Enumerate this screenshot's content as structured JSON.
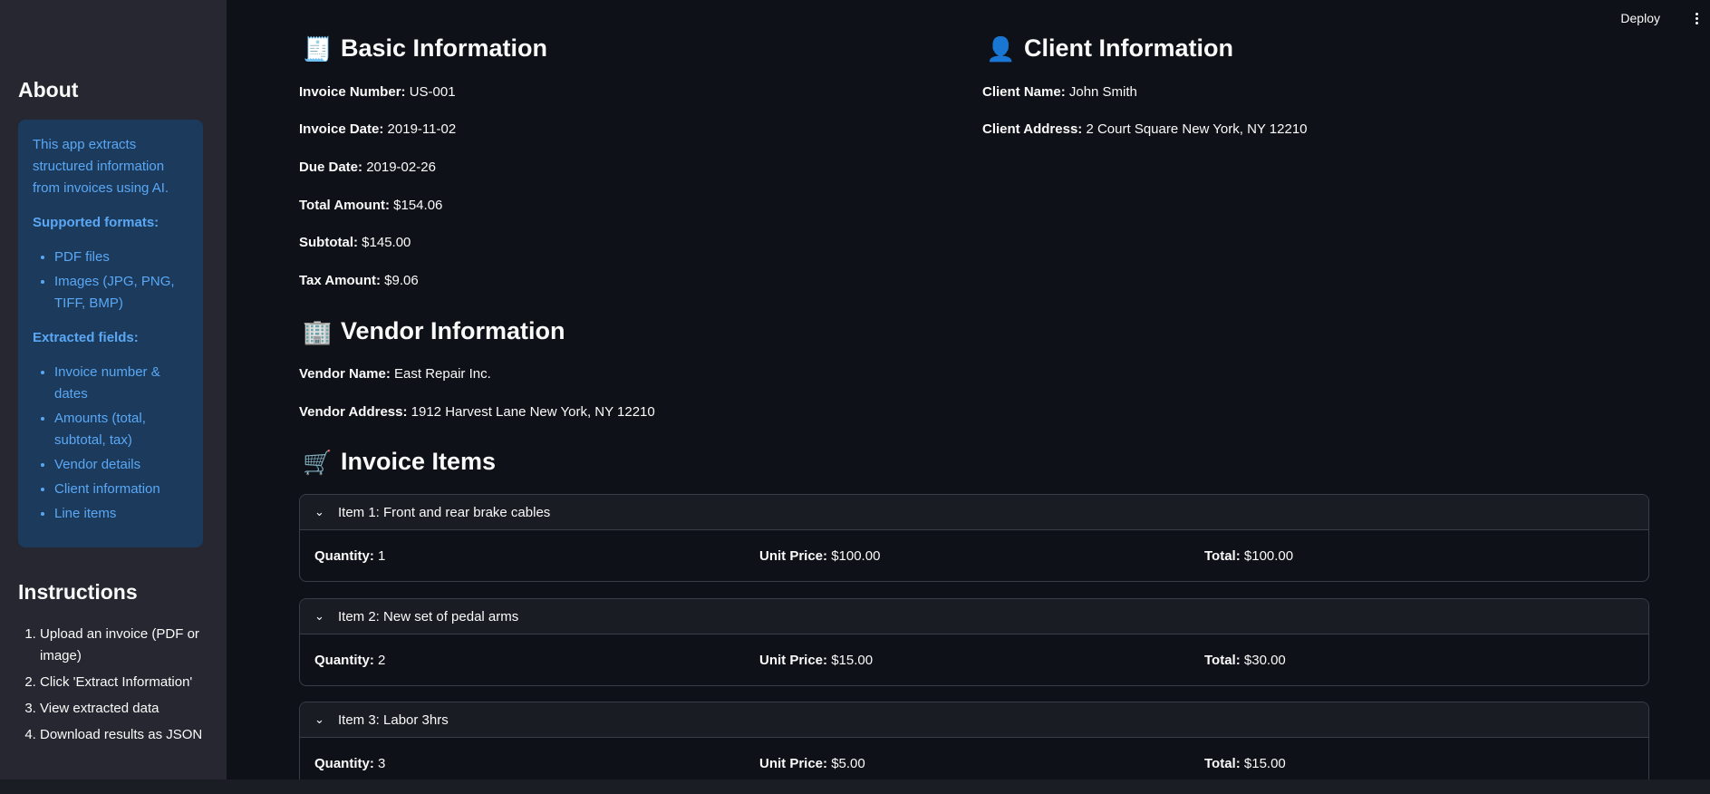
{
  "sidebar": {
    "about_title": "About",
    "about_intro": "This app extracts structured information from invoices using AI.",
    "supported_label": "Supported formats:",
    "supported": [
      "PDF files",
      "Images (JPG, PNG, TIFF, BMP)"
    ],
    "extracted_label": "Extracted fields:",
    "extracted": [
      "Invoice number & dates",
      "Amounts (total, subtotal, tax)",
      "Vendor details",
      "Client information",
      "Line items"
    ],
    "instructions_title": "Instructions",
    "instructions": [
      "Upload an invoice (PDF or image)",
      "Click 'Extract Information'",
      "View extracted data",
      "Download results as JSON"
    ]
  },
  "topbar": {
    "deploy_label": "Deploy"
  },
  "basic": {
    "title": "Basic Information",
    "icon": "receipt-icon",
    "fields": [
      {
        "label": "Invoice Number:",
        "value": "US-001"
      },
      {
        "label": "Invoice Date:",
        "value": "2019-11-02"
      },
      {
        "label": "Due Date:",
        "value": "2019-02-26"
      },
      {
        "label": "Total Amount:",
        "value": "$154.06"
      },
      {
        "label": "Subtotal:",
        "value": "$145.00"
      },
      {
        "label": "Tax Amount:",
        "value": "$9.06"
      }
    ]
  },
  "client": {
    "title": "Client Information",
    "icon": "person-icon",
    "fields": [
      {
        "label": "Client Name:",
        "value": "John Smith"
      },
      {
        "label": "Client Address:",
        "value": "2 Court Square New York, NY 12210"
      }
    ]
  },
  "vendor": {
    "title": "Vendor Information",
    "icon": "building-icon",
    "fields": [
      {
        "label": "Vendor Name:",
        "value": "East Repair Inc."
      },
      {
        "label": "Vendor Address:",
        "value": "1912 Harvest Lane New York, NY 12210"
      }
    ]
  },
  "items": {
    "title": "Invoice Items",
    "icon": "cart-icon",
    "qty_label": "Quantity:",
    "price_label": "Unit Price:",
    "total_label": "Total:",
    "list": [
      {
        "header": "Item 1: Front and rear brake cables",
        "qty": "1",
        "price": "$100.00",
        "total": "$100.00"
      },
      {
        "header": "Item 2: New set of pedal arms",
        "qty": "2",
        "price": "$15.00",
        "total": "$30.00"
      },
      {
        "header": "Item 3: Labor 3hrs",
        "qty": "3",
        "price": "$5.00",
        "total": "$15.00"
      }
    ]
  }
}
